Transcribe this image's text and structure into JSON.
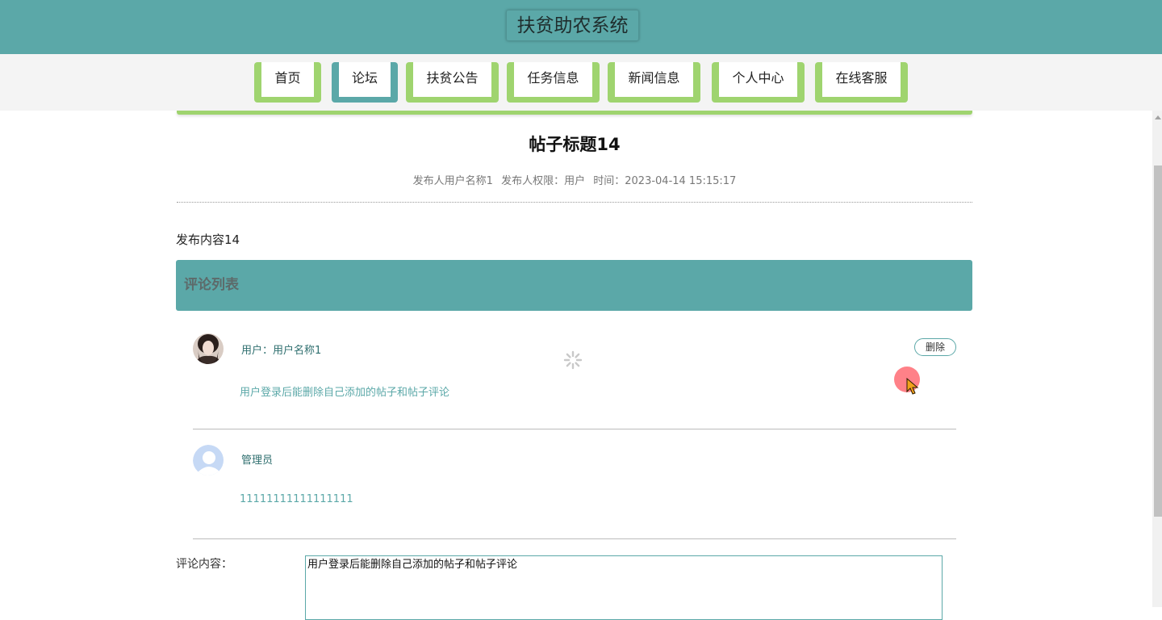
{
  "header": {
    "title": "扶贫助农系统"
  },
  "nav": {
    "items": [
      {
        "label": "首页"
      },
      {
        "label": "论坛"
      },
      {
        "label": "扶贫公告"
      },
      {
        "label": "任务信息"
      },
      {
        "label": "新闻信息"
      },
      {
        "label": "个人中心"
      },
      {
        "label": "在线客服"
      }
    ],
    "active": "论坛"
  },
  "post": {
    "title": "帖子标题14",
    "publisher": "发布人用户名称1",
    "role": "发布人权限：用户",
    "time": "时间：2023-04-14 15:15:17",
    "content": "发布内容14"
  },
  "comments": {
    "header": "评论列表",
    "items": [
      {
        "user": "用户：用户名称1",
        "text": "用户登录后能删除自己添加的帖子和帖子评论",
        "delete_label": "删除",
        "avatar": "user-photo"
      },
      {
        "user": "管理员",
        "text": "11111111111111111",
        "avatar": "default-avatar"
      }
    ]
  },
  "form": {
    "label": "评论内容：",
    "value": "用户登录后能删除自己添加的帖子和帖子评论"
  },
  "colors": {
    "primary": "#5ba8a8",
    "accent": "#9fd46f"
  }
}
